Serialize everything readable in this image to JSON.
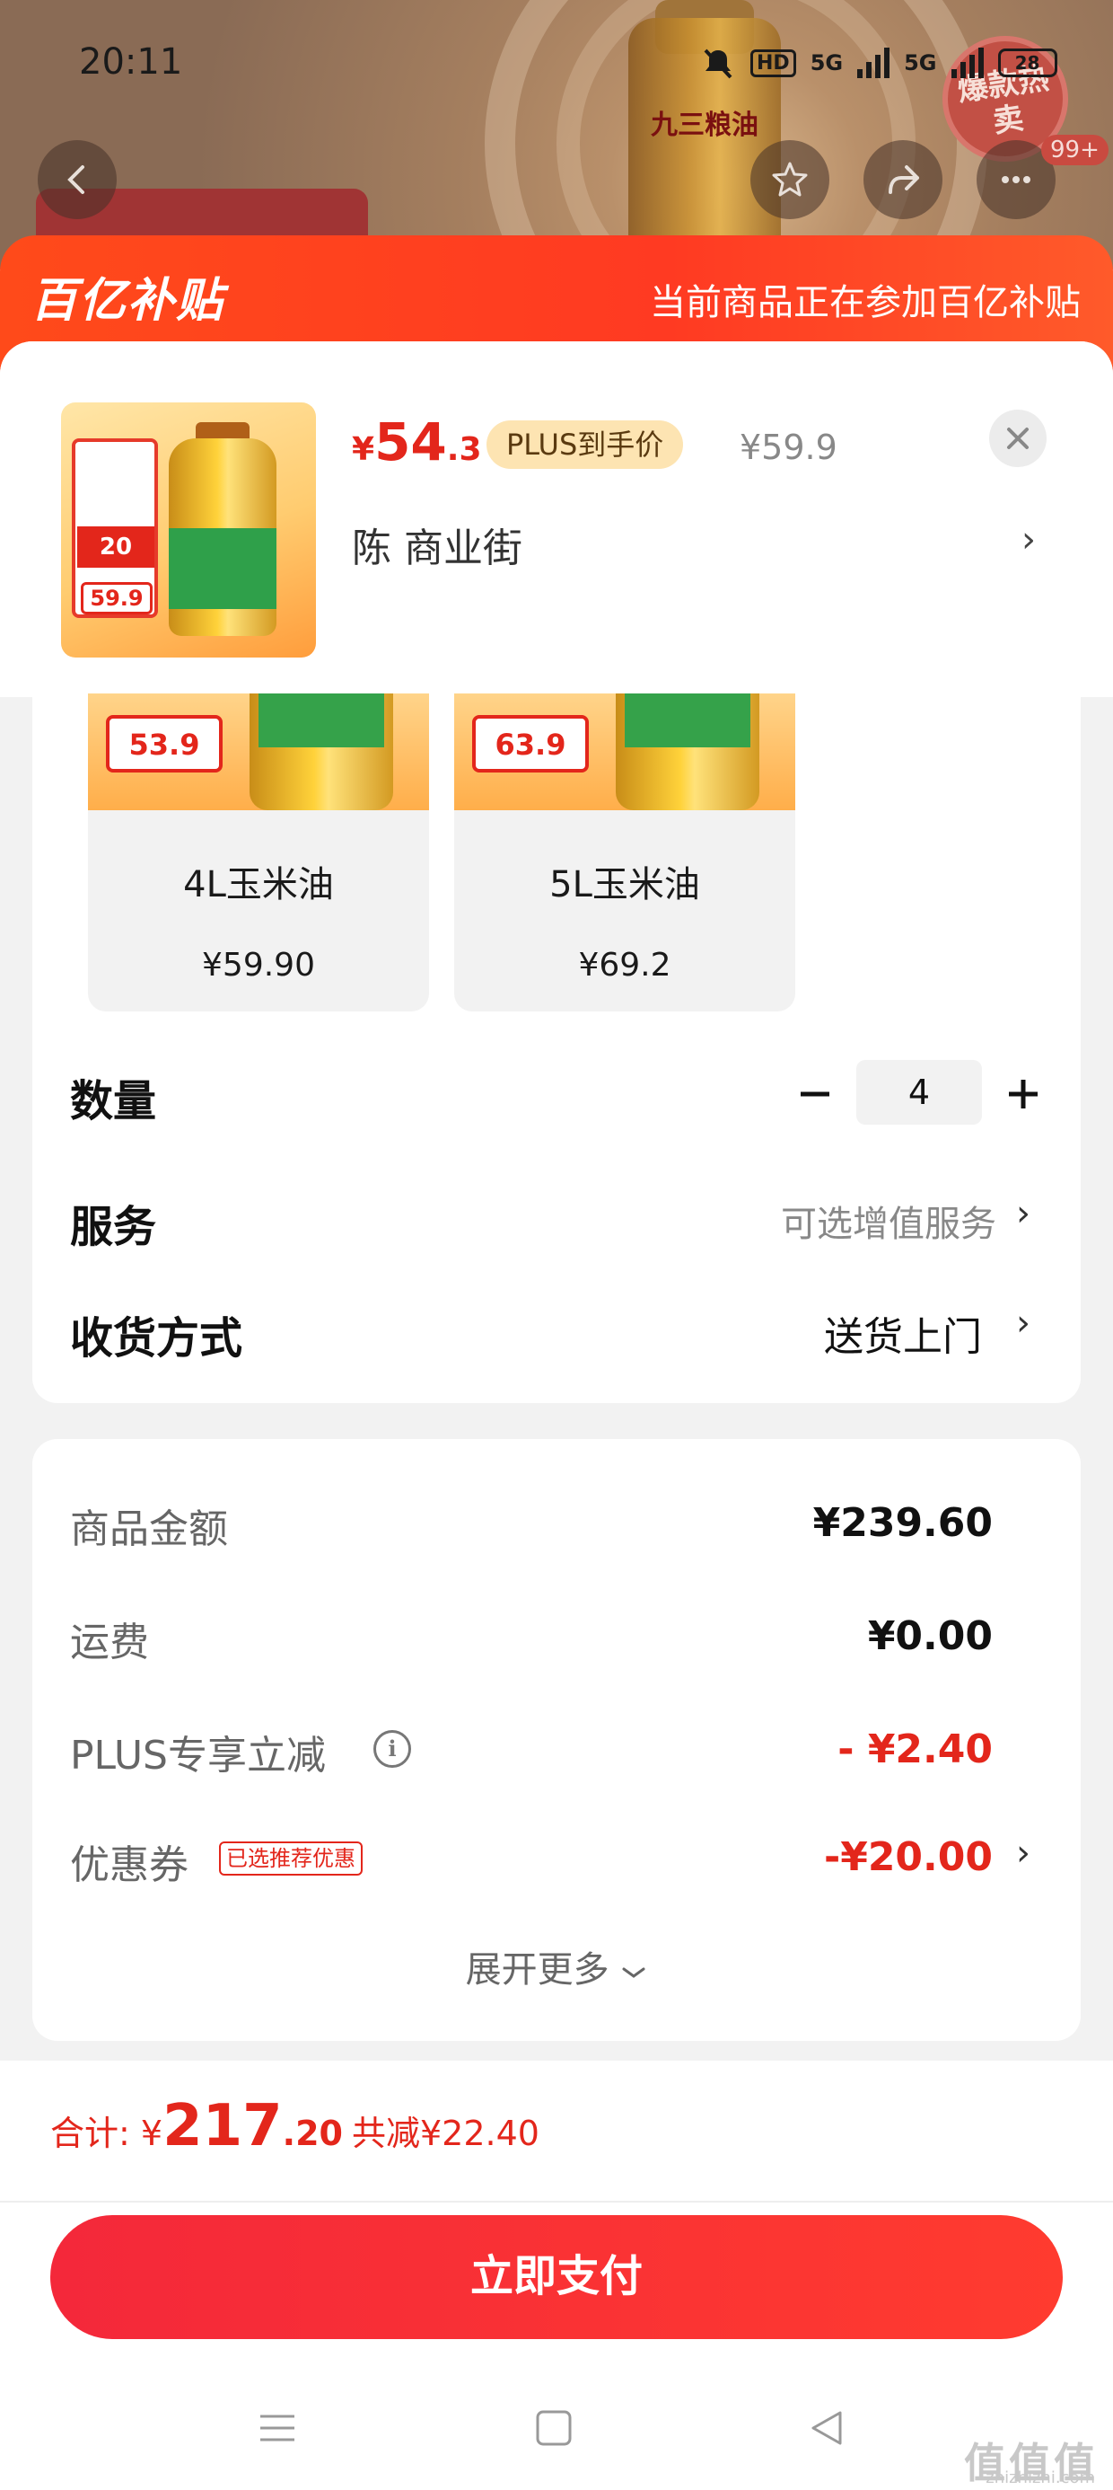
{
  "status_bar": {
    "time": "20:11",
    "hd": "HD",
    "net1": "5G",
    "net2": "5G",
    "battery": "28"
  },
  "background": {
    "bottle_label": "九三粮油",
    "hot_stamp": "爆款热卖",
    "badge_count": "99+"
  },
  "header": {
    "brand": "百亿补贴",
    "notice": "当前商品正在参加百亿补贴"
  },
  "product": {
    "price_currency": "¥",
    "price_int": "54",
    "price_dec": ".3",
    "plus_tag": "PLUS到手价",
    "original_price": "¥59.9",
    "address": "陈 商业街",
    "thumb_coupon": "20",
    "thumb_price": "59.9"
  },
  "variants": [
    {
      "tag_price": "53.9",
      "name": "4L玉米油",
      "price": "¥59.90"
    },
    {
      "tag_price": "63.9",
      "name": "5L玉米油",
      "price": "¥69.2"
    }
  ],
  "options": {
    "quantity_label": "数量",
    "quantity_value": "4",
    "service_label": "服务",
    "service_value": "可选增值服务",
    "delivery_label": "收货方式",
    "delivery_value": "送货上门"
  },
  "costs": {
    "goods_label": "商品金额",
    "goods_value": "¥239.60",
    "shipping_label": "运费",
    "shipping_value": "¥0.00",
    "plus_label": "PLUS专享立减",
    "plus_value": "- ¥2.40",
    "coupon_label": "优惠券",
    "coupon_tag": "已选推荐优惠",
    "coupon_value": "-¥20.00",
    "expand_label": "展开更多"
  },
  "footer": {
    "total_label": "合计: ¥",
    "total_int": "217",
    "total_dec": ".20",
    "savings": "共减¥22.40",
    "pay_button": "立即支付"
  },
  "watermark": {
    "text": "值值值",
    "sub": "zhizhizhi.com"
  },
  "colors": {
    "accent_red": "#e3261b",
    "header_orange": "#ff4a1a",
    "plus_gold": "#fde4b2"
  }
}
